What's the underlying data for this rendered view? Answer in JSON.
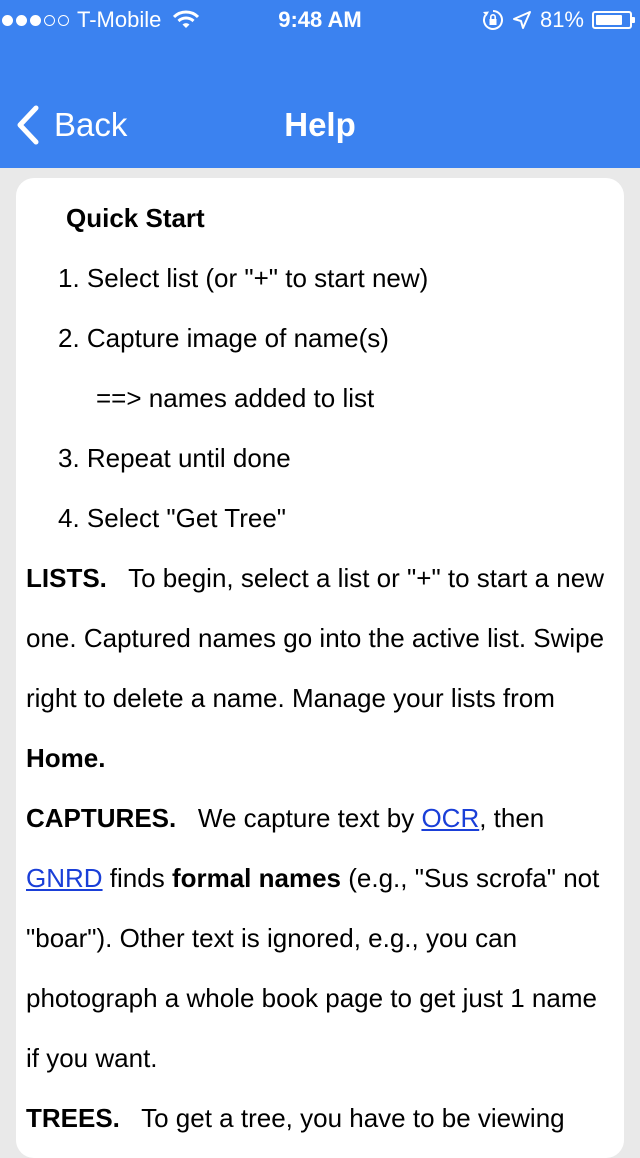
{
  "status_bar": {
    "carrier": "T-Mobile",
    "time": "9:48 AM",
    "battery": "81%",
    "battery_level": 0.81,
    "signal_bars_filled": 3,
    "signal_bars_total": 5
  },
  "nav": {
    "back_label": "Back",
    "title": "Help"
  },
  "help": {
    "quick_start_title": "Quick Start",
    "steps": [
      "1. Select list (or \"+\" to start new)",
      "2. Capture image of name(s)",
      "==> names added to list",
      "3. Repeat until done",
      "4. Select \"Get Tree\""
    ],
    "lists": {
      "heading": "LISTS.",
      "text": "To begin, select a list or \"+\" to start a new one. Captured names go into the active list. Swipe right to delete a name. Manage your lists from ",
      "home": "Home."
    },
    "captures": {
      "heading": "CAPTURES.",
      "text1": "We capture text by ",
      "ocr_link": "OCR",
      "text2": ", then ",
      "gnrd_link": "GNRD",
      "text3": " finds ",
      "formal_names": "formal names",
      "text4": " (e.g., \"Sus scrofa\" not \"boar\"). Other text is ignored, e.g., you can photograph a whole book page to get just 1 name if you want."
    },
    "trees": {
      "heading": "TREES.",
      "text": "To get a tree, you have to be viewing"
    }
  },
  "colors": {
    "nav_bg": "#3b82f0",
    "page_bg": "#e9e9e9",
    "card_bg": "#ffffff",
    "link": "#1a3fd8"
  }
}
